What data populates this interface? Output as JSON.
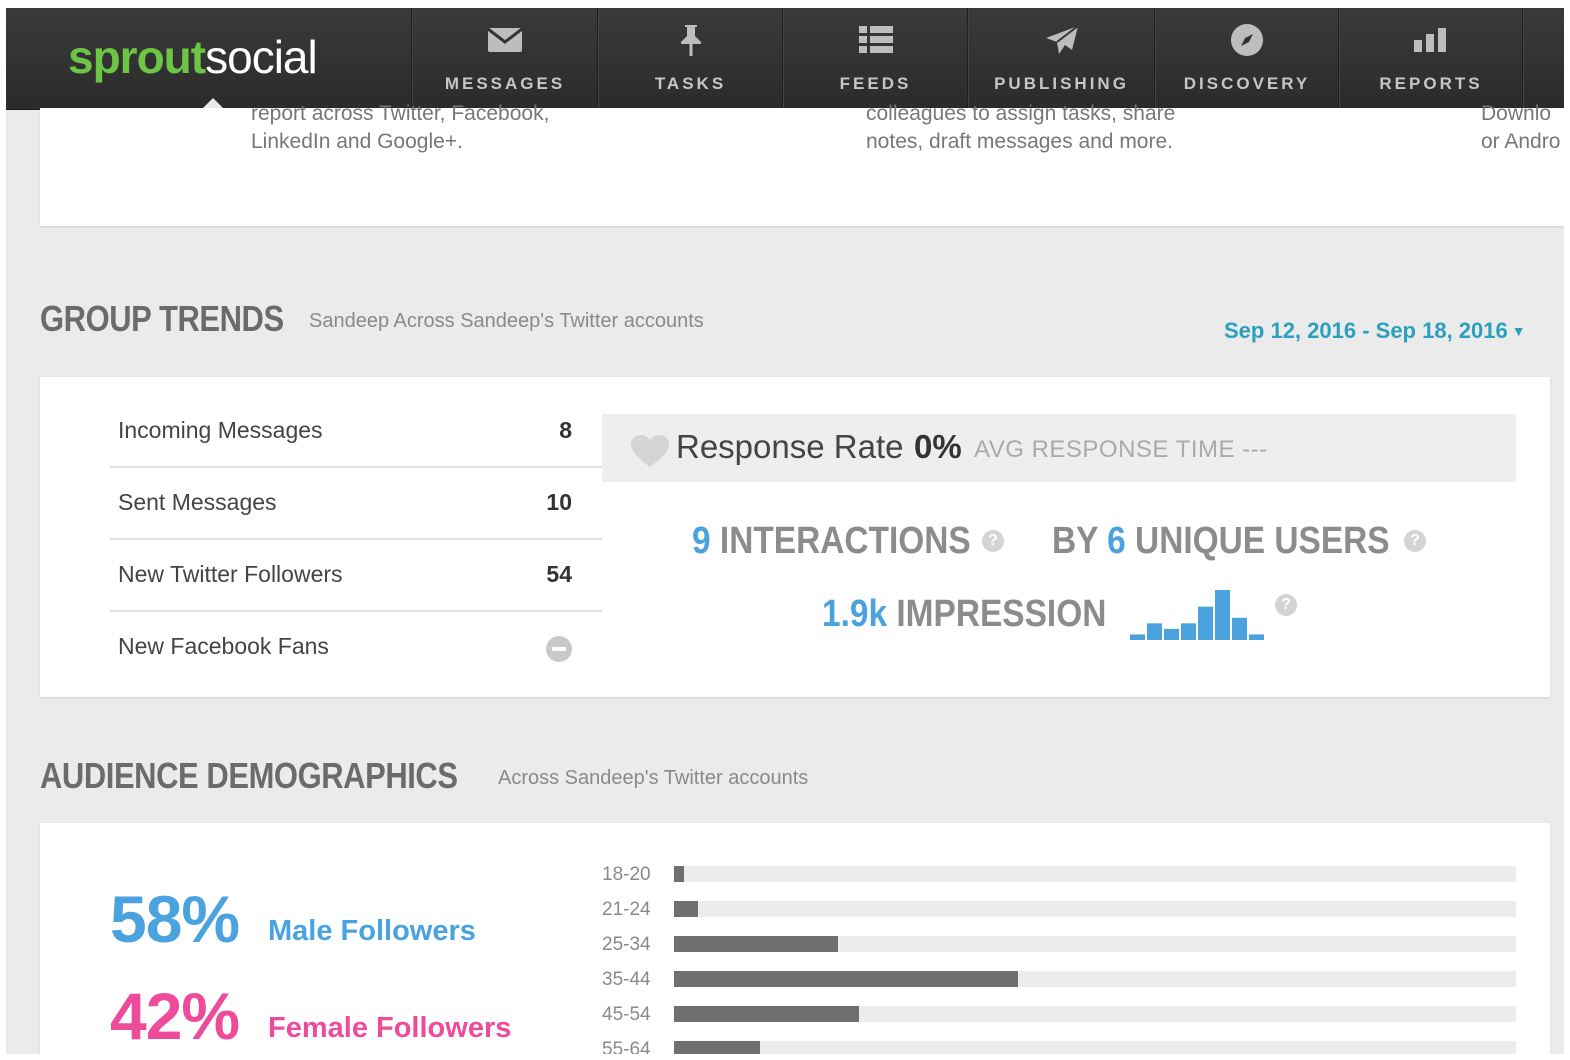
{
  "app": {
    "logo_part1": "sprout",
    "logo_part2": "social"
  },
  "nav": {
    "items": [
      {
        "label": "MESSAGES",
        "icon": "envelope-icon"
      },
      {
        "label": "TASKS",
        "icon": "pin-icon"
      },
      {
        "label": "FEEDS",
        "icon": "list-icon"
      },
      {
        "label": "PUBLISHING",
        "icon": "paper-plane-icon"
      },
      {
        "label": "DISCOVERY",
        "icon": "compass-icon"
      },
      {
        "label": "REPORTS",
        "icon": "bar-chart-icon"
      }
    ]
  },
  "features": {
    "left_line1": "report across Twitter, Facebook,",
    "left_line2": "LinkedIn and Google+.",
    "mid_line1": "colleagues to assign tasks, share",
    "mid_line2": "notes, draft messages and more.",
    "right_line1": "Downlo",
    "right_line2": "or Andro"
  },
  "group_trends": {
    "title": "GROUP TRENDS",
    "subtitle": "Sandeep Across Sandeep's Twitter accounts",
    "date_range": "Sep 12, 2016 - Sep 18, 2016",
    "stats": [
      {
        "name": "Incoming Messages",
        "value": "8"
      },
      {
        "name": "Sent Messages",
        "value": "10"
      },
      {
        "name": "New Twitter Followers",
        "value": "54"
      },
      {
        "name": "New Facebook Fans",
        "value": ""
      }
    ],
    "response_rate_label": "Response Rate",
    "response_rate_value": "0%",
    "avg_response_label": "AVG RESPONSE TIME ---",
    "interactions_count": "9",
    "interactions_label": "INTERACTIONS",
    "by_label": "BY",
    "unique_users_count": "6",
    "unique_users_label": "UNIQUE USERS",
    "impressions_count": "1.9k",
    "impressions_label": "IMPRESSION",
    "impression_sparkline": [
      1,
      3,
      2,
      3,
      6,
      9,
      4,
      1
    ],
    "help_icon": "?"
  },
  "audience": {
    "title": "AUDIENCE DEMOGRAPHICS",
    "subtitle": "Across Sandeep's Twitter accounts",
    "male_pct": "58%",
    "male_label": "Male Followers",
    "female_pct": "42%",
    "female_label": "Female Followers",
    "colors": {
      "male": "#4aa3df",
      "female": "#ee4b9b"
    },
    "age_groups": [
      {
        "label": "18-20",
        "fraction": 0.012
      },
      {
        "label": "21-24",
        "fraction": 0.029
      },
      {
        "label": "25-34",
        "fraction": 0.195
      },
      {
        "label": "35-44",
        "fraction": 0.408
      },
      {
        "label": "45-54",
        "fraction": 0.22
      },
      {
        "label": "55-64",
        "fraction": 0.102
      }
    ]
  }
}
